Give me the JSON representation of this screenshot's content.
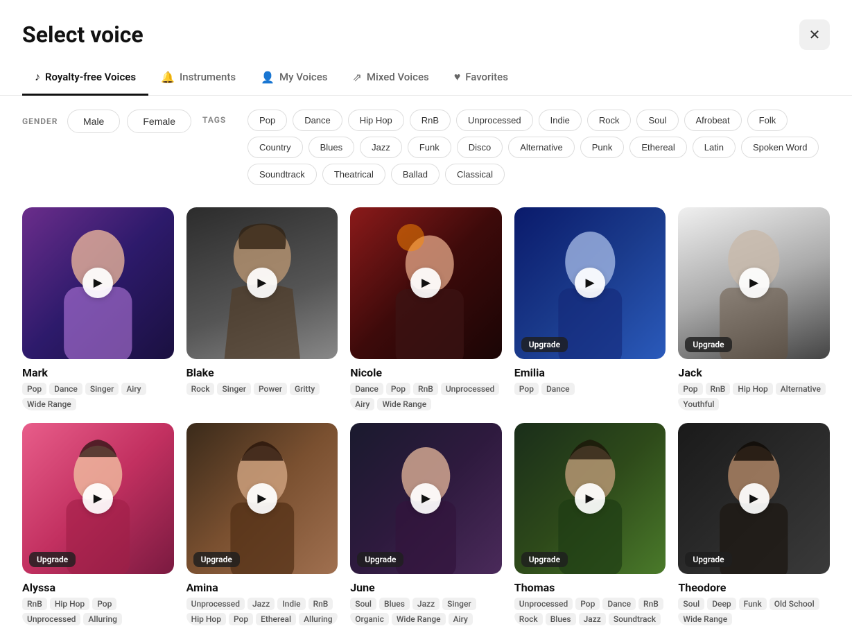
{
  "page": {
    "title": "Select voice"
  },
  "nav": {
    "tabs": [
      {
        "id": "royalty-free",
        "label": "Royalty-free Voices",
        "icon": "♪",
        "active": true
      },
      {
        "id": "instruments",
        "label": "Instruments",
        "icon": "🔔",
        "active": false
      },
      {
        "id": "my-voices",
        "label": "My Voices",
        "icon": "👤",
        "active": false
      },
      {
        "id": "mixed-voices",
        "label": "Mixed Voices",
        "icon": "↗",
        "active": false
      },
      {
        "id": "favorites",
        "label": "Favorites",
        "icon": "♥",
        "active": false
      }
    ]
  },
  "filters": {
    "gender_label": "GENDER",
    "tags_label": "TAGS",
    "gender_options": [
      "Male",
      "Female"
    ],
    "tags": [
      "Pop",
      "Dance",
      "Hip Hop",
      "RnB",
      "Unprocessed",
      "Indie",
      "Rock",
      "Soul",
      "Afrobeat",
      "Folk",
      "Country",
      "Blues",
      "Jazz",
      "Funk",
      "Disco",
      "Alternative",
      "Punk",
      "Ethereal",
      "Latin",
      "Spoken Word",
      "Soundtrack",
      "Theatrical",
      "Ballad",
      "Classical"
    ]
  },
  "voices": [
    {
      "id": "mark",
      "name": "Mark",
      "tags": [
        "Pop",
        "Dance",
        "Singer",
        "Airy",
        "Wide Range"
      ],
      "upgrade": false,
      "bg": "mark"
    },
    {
      "id": "blake",
      "name": "Blake",
      "tags": [
        "Rock",
        "Singer",
        "Power",
        "Gritty"
      ],
      "upgrade": false,
      "bg": "blake"
    },
    {
      "id": "nicole",
      "name": "Nicole",
      "tags": [
        "Dance",
        "Pop",
        "RnB",
        "Unprocessed",
        "Airy",
        "Wide Range"
      ],
      "upgrade": false,
      "bg": "nicole"
    },
    {
      "id": "emilia",
      "name": "Emilia",
      "tags": [
        "Pop",
        "Dance"
      ],
      "upgrade": true,
      "bg": "emilia"
    },
    {
      "id": "jack",
      "name": "Jack",
      "tags": [
        "Pop",
        "RnB",
        "Hip Hop",
        "Alternative",
        "Youthful"
      ],
      "upgrade": true,
      "bg": "jack"
    },
    {
      "id": "alyssa",
      "name": "Alyssa",
      "tags": [
        "RnB",
        "Hip Hop",
        "Pop",
        "Unprocessed",
        "Alluring"
      ],
      "upgrade": true,
      "bg": "alyssa"
    },
    {
      "id": "amina",
      "name": "Amina",
      "tags": [
        "Unprocessed",
        "Jazz",
        "Indie",
        "RnB",
        "Hip Hop",
        "Pop",
        "Ethereal",
        "Alluring"
      ],
      "upgrade": true,
      "bg": "amina"
    },
    {
      "id": "june",
      "name": "June",
      "tags": [
        "Soul",
        "Blues",
        "Jazz",
        "Singer",
        "Organic",
        "Wide Range",
        "Airy"
      ],
      "upgrade": true,
      "bg": "june"
    },
    {
      "id": "thomas",
      "name": "Thomas",
      "tags": [
        "Unprocessed",
        "Pop",
        "Dance",
        "RnB",
        "Rock",
        "Blues",
        "Jazz",
        "Soundtrack"
      ],
      "upgrade": true,
      "bg": "thomas"
    },
    {
      "id": "theodore",
      "name": "Theodore",
      "tags": [
        "Soul",
        "Deep",
        "Funk",
        "Old School",
        "Wide Range"
      ],
      "upgrade": true,
      "bg": "theodore"
    }
  ],
  "labels": {
    "upgrade": "Upgrade",
    "close": "✕"
  },
  "bottom_tags": {
    "alyssa": "Alluring",
    "amina_bottom": "Alluring",
    "june_bottom": "Airy",
    "thomas_bottom": "Soundtrack",
    "theodore_bottom": "Wide Range"
  }
}
